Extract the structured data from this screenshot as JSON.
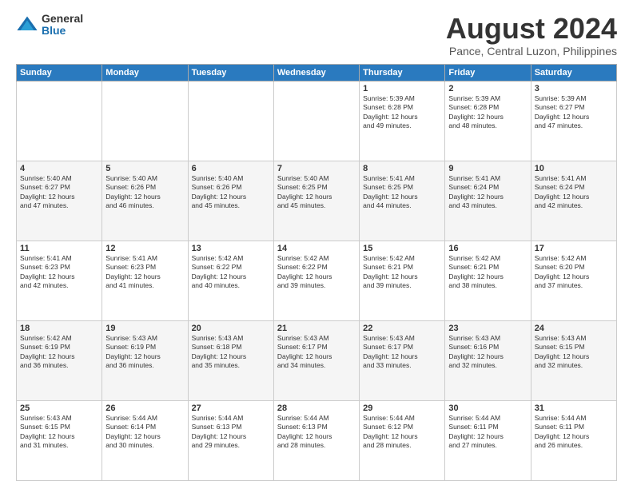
{
  "logo": {
    "general": "General",
    "blue": "Blue"
  },
  "title": "August 2024",
  "subtitle": "Pance, Central Luzon, Philippines",
  "headers": [
    "Sunday",
    "Monday",
    "Tuesday",
    "Wednesday",
    "Thursday",
    "Friday",
    "Saturday"
  ],
  "weeks": [
    [
      {
        "day": "",
        "info": ""
      },
      {
        "day": "",
        "info": ""
      },
      {
        "day": "",
        "info": ""
      },
      {
        "day": "",
        "info": ""
      },
      {
        "day": "1",
        "info": "Sunrise: 5:39 AM\nSunset: 6:28 PM\nDaylight: 12 hours\nand 49 minutes."
      },
      {
        "day": "2",
        "info": "Sunrise: 5:39 AM\nSunset: 6:28 PM\nDaylight: 12 hours\nand 48 minutes."
      },
      {
        "day": "3",
        "info": "Sunrise: 5:39 AM\nSunset: 6:27 PM\nDaylight: 12 hours\nand 47 minutes."
      }
    ],
    [
      {
        "day": "4",
        "info": "Sunrise: 5:40 AM\nSunset: 6:27 PM\nDaylight: 12 hours\nand 47 minutes."
      },
      {
        "day": "5",
        "info": "Sunrise: 5:40 AM\nSunset: 6:26 PM\nDaylight: 12 hours\nand 46 minutes."
      },
      {
        "day": "6",
        "info": "Sunrise: 5:40 AM\nSunset: 6:26 PM\nDaylight: 12 hours\nand 45 minutes."
      },
      {
        "day": "7",
        "info": "Sunrise: 5:40 AM\nSunset: 6:25 PM\nDaylight: 12 hours\nand 45 minutes."
      },
      {
        "day": "8",
        "info": "Sunrise: 5:41 AM\nSunset: 6:25 PM\nDaylight: 12 hours\nand 44 minutes."
      },
      {
        "day": "9",
        "info": "Sunrise: 5:41 AM\nSunset: 6:24 PM\nDaylight: 12 hours\nand 43 minutes."
      },
      {
        "day": "10",
        "info": "Sunrise: 5:41 AM\nSunset: 6:24 PM\nDaylight: 12 hours\nand 42 minutes."
      }
    ],
    [
      {
        "day": "11",
        "info": "Sunrise: 5:41 AM\nSunset: 6:23 PM\nDaylight: 12 hours\nand 42 minutes."
      },
      {
        "day": "12",
        "info": "Sunrise: 5:41 AM\nSunset: 6:23 PM\nDaylight: 12 hours\nand 41 minutes."
      },
      {
        "day": "13",
        "info": "Sunrise: 5:42 AM\nSunset: 6:22 PM\nDaylight: 12 hours\nand 40 minutes."
      },
      {
        "day": "14",
        "info": "Sunrise: 5:42 AM\nSunset: 6:22 PM\nDaylight: 12 hours\nand 39 minutes."
      },
      {
        "day": "15",
        "info": "Sunrise: 5:42 AM\nSunset: 6:21 PM\nDaylight: 12 hours\nand 39 minutes."
      },
      {
        "day": "16",
        "info": "Sunrise: 5:42 AM\nSunset: 6:21 PM\nDaylight: 12 hours\nand 38 minutes."
      },
      {
        "day": "17",
        "info": "Sunrise: 5:42 AM\nSunset: 6:20 PM\nDaylight: 12 hours\nand 37 minutes."
      }
    ],
    [
      {
        "day": "18",
        "info": "Sunrise: 5:42 AM\nSunset: 6:19 PM\nDaylight: 12 hours\nand 36 minutes."
      },
      {
        "day": "19",
        "info": "Sunrise: 5:43 AM\nSunset: 6:19 PM\nDaylight: 12 hours\nand 36 minutes."
      },
      {
        "day": "20",
        "info": "Sunrise: 5:43 AM\nSunset: 6:18 PM\nDaylight: 12 hours\nand 35 minutes."
      },
      {
        "day": "21",
        "info": "Sunrise: 5:43 AM\nSunset: 6:17 PM\nDaylight: 12 hours\nand 34 minutes."
      },
      {
        "day": "22",
        "info": "Sunrise: 5:43 AM\nSunset: 6:17 PM\nDaylight: 12 hours\nand 33 minutes."
      },
      {
        "day": "23",
        "info": "Sunrise: 5:43 AM\nSunset: 6:16 PM\nDaylight: 12 hours\nand 32 minutes."
      },
      {
        "day": "24",
        "info": "Sunrise: 5:43 AM\nSunset: 6:15 PM\nDaylight: 12 hours\nand 32 minutes."
      }
    ],
    [
      {
        "day": "25",
        "info": "Sunrise: 5:43 AM\nSunset: 6:15 PM\nDaylight: 12 hours\nand 31 minutes."
      },
      {
        "day": "26",
        "info": "Sunrise: 5:44 AM\nSunset: 6:14 PM\nDaylight: 12 hours\nand 30 minutes."
      },
      {
        "day": "27",
        "info": "Sunrise: 5:44 AM\nSunset: 6:13 PM\nDaylight: 12 hours\nand 29 minutes."
      },
      {
        "day": "28",
        "info": "Sunrise: 5:44 AM\nSunset: 6:13 PM\nDaylight: 12 hours\nand 28 minutes."
      },
      {
        "day": "29",
        "info": "Sunrise: 5:44 AM\nSunset: 6:12 PM\nDaylight: 12 hours\nand 28 minutes."
      },
      {
        "day": "30",
        "info": "Sunrise: 5:44 AM\nSunset: 6:11 PM\nDaylight: 12 hours\nand 27 minutes."
      },
      {
        "day": "31",
        "info": "Sunrise: 5:44 AM\nSunset: 6:11 PM\nDaylight: 12 hours\nand 26 minutes."
      }
    ]
  ]
}
